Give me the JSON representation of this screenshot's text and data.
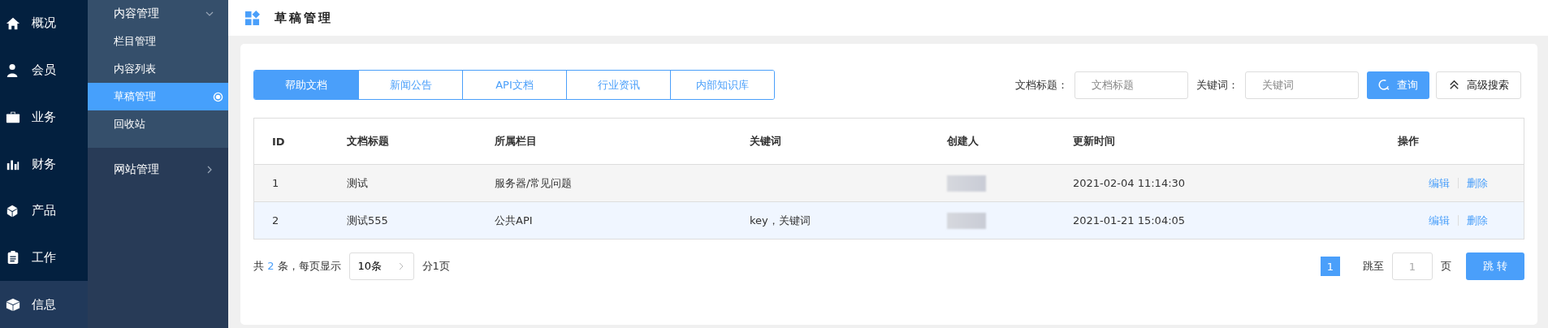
{
  "nav": [
    {
      "label": "概况",
      "selected": false
    },
    {
      "label": "会员",
      "selected": false
    },
    {
      "label": "业务",
      "selected": false
    },
    {
      "label": "财务",
      "selected": false
    },
    {
      "label": "产品",
      "selected": false
    },
    {
      "label": "工作",
      "selected": false
    },
    {
      "label": "信息",
      "selected": true
    }
  ],
  "submenu": [
    {
      "label": "内容管理",
      "expanded": true,
      "children": [
        {
          "label": "栏目管理",
          "selected": false
        },
        {
          "label": "内容列表",
          "selected": false
        },
        {
          "label": "草稿管理",
          "selected": true
        },
        {
          "label": "回收站",
          "selected": false
        }
      ]
    },
    {
      "label": "网站管理",
      "expanded": false
    }
  ],
  "page_title": "草稿管理",
  "tabs": [
    {
      "label": "帮助文档",
      "selected": true
    },
    {
      "label": "新闻公告",
      "selected": false
    },
    {
      "label": "API文档",
      "selected": false
    },
    {
      "label": "行业资讯",
      "selected": false
    },
    {
      "label": "内部知识库",
      "selected": false
    }
  ],
  "filters": [
    {
      "label": "文档标题：",
      "placeholder": "文档标题"
    },
    {
      "label": "关键词：",
      "placeholder": "关键词"
    }
  ],
  "search_button": "查询",
  "advanced_button": "高级搜索",
  "table": {
    "columns": [
      "ID",
      "文档标题",
      "所属栏目",
      "关键词",
      "创建人",
      "更新时间",
      "操作"
    ],
    "rows": [
      {
        "id": "1",
        "title": "测试",
        "category": "服务器/常见问题",
        "updated": "2021-02-04 11:14:30",
        "actions": [
          "编辑",
          "删除"
        ]
      },
      {
        "id": "2",
        "title": "测试555",
        "category": "公共API",
        "keywords": "key，关键词",
        "updated": "2021-01-21 15:04:05",
        "actions": [
          "编辑",
          "删除"
        ]
      }
    ]
  },
  "pagination": {
    "total_prefix": "共",
    "total": "2",
    "total_suffix": "条，每页显示",
    "page_size": "10条",
    "page_count": "分1页",
    "pages": [
      {
        "label": "1",
        "selected": true
      }
    ],
    "jump_label": "跳至",
    "jump_placeholder": "1",
    "page_unit": "页",
    "jump_button": "跳 转"
  }
}
